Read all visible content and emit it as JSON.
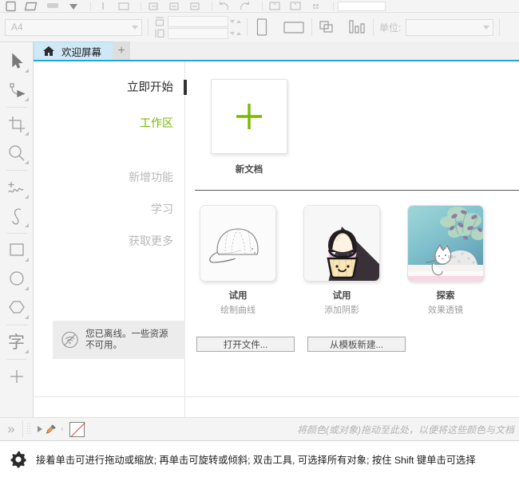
{
  "app": {
    "accent_green": "#7AB800",
    "tab_accent_blue": "#1EA8D8",
    "tab_bg": "#CFE8F7"
  },
  "toolbar": {
    "paper_size": {
      "label": "A4",
      "placeholder": "A4"
    },
    "width_field": "",
    "height_field": "",
    "unit_label": "单位:",
    "unit_value": "",
    "icons": [
      "new-document-icon",
      "open-document-icon",
      "save-icon",
      "undo-dropdown-icon",
      "import-icon",
      "export-icon",
      "publish-pdf-icon",
      "align-left-icon",
      "align-center-icon",
      "align-right-icon",
      "undo-icon",
      "redo-icon",
      "zoom-level-icon",
      "fullscreen-icon",
      "options-icon"
    ]
  },
  "toolbox": {
    "tools": [
      {
        "name": "pick-tool",
        "icon": "cursor-arrow-icon"
      },
      {
        "name": "shape-tool",
        "icon": "node-edit-icon"
      },
      {
        "name": "crop-tool",
        "icon": "crop-icon"
      },
      {
        "name": "zoom-tool",
        "icon": "magnifier-icon"
      },
      {
        "name": "freehand-tool",
        "icon": "freehand-curve-icon"
      },
      {
        "name": "artistic-media-tool",
        "icon": "artistic-media-icon"
      },
      {
        "name": "rectangle-tool",
        "icon": "rectangle-icon"
      },
      {
        "name": "ellipse-tool",
        "icon": "ellipse-icon"
      },
      {
        "name": "polygon-tool",
        "icon": "polygon-icon"
      },
      {
        "name": "text-tool",
        "icon": "text-char-icon",
        "glyph": "字"
      },
      {
        "name": "add-tool",
        "icon": "plus-icon"
      }
    ]
  },
  "tabbar": {
    "home_icon": "home-icon",
    "tab_label": "欢迎屏幕",
    "new_tab_label": "+"
  },
  "welcome": {
    "nav": [
      {
        "label": "立即开始",
        "state": "current"
      },
      {
        "label": "工作区",
        "state": "active"
      },
      {
        "label": "新增功能",
        "state": "muted"
      },
      {
        "label": "学习",
        "state": "muted"
      },
      {
        "label": "获取更多",
        "state": "muted"
      }
    ],
    "offline": {
      "icon": "no-wifi-icon",
      "message": "您已离线。一些资源不可用。"
    },
    "new_document": {
      "icon": "plus-icon",
      "label": "新文档"
    },
    "cards": [
      {
        "title": "试用",
        "subtitle": "绘制曲线",
        "thumb": "baseball-cap-sketch"
      },
      {
        "title": "试用",
        "subtitle": "添加阴影",
        "thumb": "cupcake-long-shadow"
      },
      {
        "title": "探索",
        "subtitle": "效果透镜",
        "thumb": "sleeping-cat-foliage"
      }
    ],
    "buttons": [
      {
        "name": "open-file-button",
        "label": "打开文件..."
      },
      {
        "name": "new-from-template-button",
        "label": "从模板新建..."
      }
    ]
  },
  "palettebar": {
    "expand_glyph": "»",
    "arrow_icon": "palette-arrow-icon",
    "eyedropper_icon": "eyedropper-icon",
    "prev_glyph": "‹",
    "no_color_swatch": "no-color-icon",
    "hint": "将颜色(或对象)拖动至此处，以便将这些颜色与文档"
  },
  "statusbar": {
    "gear_icon": "gear-icon",
    "message": "接着单击可进行拖动或缩放; 再单击可旋转或倾斜; 双击工具, 可选择所有对象; 按住 Shift 键单击可选择"
  }
}
